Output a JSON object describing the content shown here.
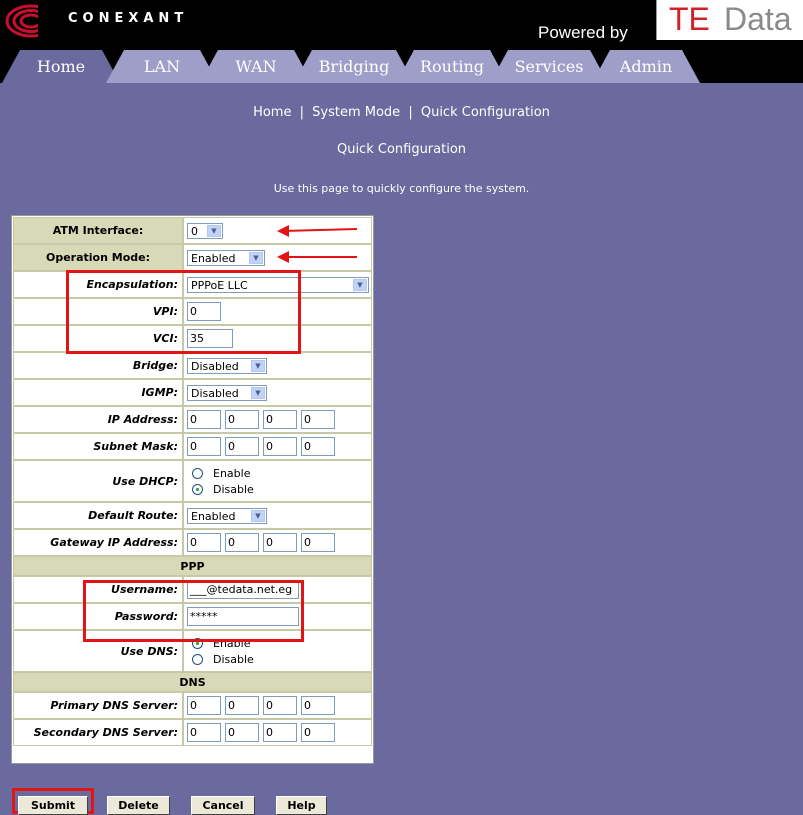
{
  "header": {
    "brand": "CONEXANT",
    "powered_by": "Powered by",
    "te": "TE",
    "data": "Data"
  },
  "tabs": [
    "Home",
    "LAN",
    "WAN",
    "Bridging",
    "Routing",
    "Services",
    "Admin"
  ],
  "breadcrumb": [
    "Home",
    "System Mode",
    "Quick Configuration"
  ],
  "page_title": "Quick Configuration",
  "description": "Use this page to quickly configure the system.",
  "form": {
    "atm_label": "ATM Interface:",
    "atm_value": "0",
    "opmode_label": "Operation Mode:",
    "opmode_value": "Enabled",
    "encap_label": "Encapsulation:",
    "encap_value": "PPPoE LLC",
    "vpi_label": "VPI:",
    "vpi_value": "0",
    "vci_label": "VCI:",
    "vci_value": "35",
    "bridge_label": "Bridge:",
    "bridge_value": "Disabled",
    "igmp_label": "IGMP:",
    "igmp_value": "Disabled",
    "ip_label": "IP Address:",
    "ip": [
      "0",
      "0",
      "0",
      "0"
    ],
    "mask_label": "Subnet Mask:",
    "mask": [
      "0",
      "0",
      "0",
      "0"
    ],
    "dhcp_label": "Use DHCP:",
    "dhcp_enable": "Enable",
    "dhcp_disable": "Disable",
    "route_label": "Default Route:",
    "route_value": "Enabled",
    "gw_label": "Gateway IP Address:",
    "gw": [
      "0",
      "0",
      "0",
      "0"
    ],
    "ppp_section": "PPP",
    "user_label": "Username:",
    "user_value": "___@tedata.net.eg",
    "pass_label": "Password:",
    "pass_value": "*****",
    "dns_label": "Use DNS:",
    "dns_enable": "Enable",
    "dns_disable": "Disable",
    "dns_section": "DNS",
    "pdns_label": "Primary DNS Server:",
    "pdns": [
      "0",
      "0",
      "0",
      "0"
    ],
    "sdns_label": "Secondary DNS Server:",
    "sdns": [
      "0",
      "0",
      "0",
      "0"
    ]
  },
  "buttons": {
    "submit": "Submit",
    "delete": "Delete",
    "cancel": "Cancel",
    "help": "Help"
  },
  "colors": {
    "background": "#6b6a9e",
    "tab": "#9f9ec9",
    "active_tab": "#6b6a9e",
    "highlight": "#e01515"
  }
}
